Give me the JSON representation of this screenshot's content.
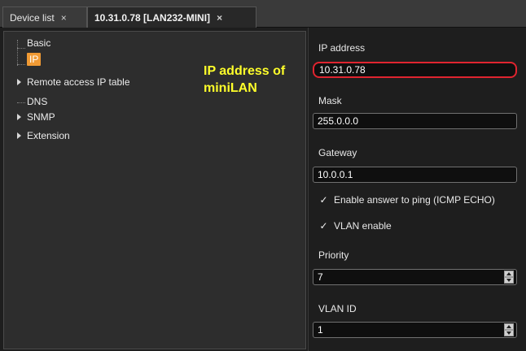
{
  "tabs": [
    {
      "label": "Device list",
      "close": "×"
    },
    {
      "label": "10.31.0.78 [LAN232-MINI]",
      "close": "×"
    }
  ],
  "tree": {
    "items": [
      {
        "label": "Basic"
      },
      {
        "label": "IP"
      },
      {
        "label": "Remote access IP table"
      },
      {
        "label": "DNS"
      },
      {
        "label": "SNMP"
      },
      {
        "label": "Extension"
      }
    ]
  },
  "annotation": {
    "line1": "IP address of",
    "line2": "miniLAN"
  },
  "settings": {
    "ip_label": "IP address",
    "ip_value": "10.31.0.78",
    "mask_label": "Mask",
    "mask_value": "255.0.0.0",
    "gateway_label": "Gateway",
    "gateway_value": "10.0.0.1",
    "ping_label": "Enable answer to ping (ICMP ECHO)",
    "vlan_enable_label": "VLAN enable",
    "check_mark": "✓",
    "priority_label": "Priority",
    "priority_value": "7",
    "vlan_id_label": "VLAN ID",
    "vlan_id_value": "1"
  },
  "colors": {
    "selection": "#f09a34",
    "annotation": "#ffff2a",
    "highlight_ring": "#e0242f"
  }
}
